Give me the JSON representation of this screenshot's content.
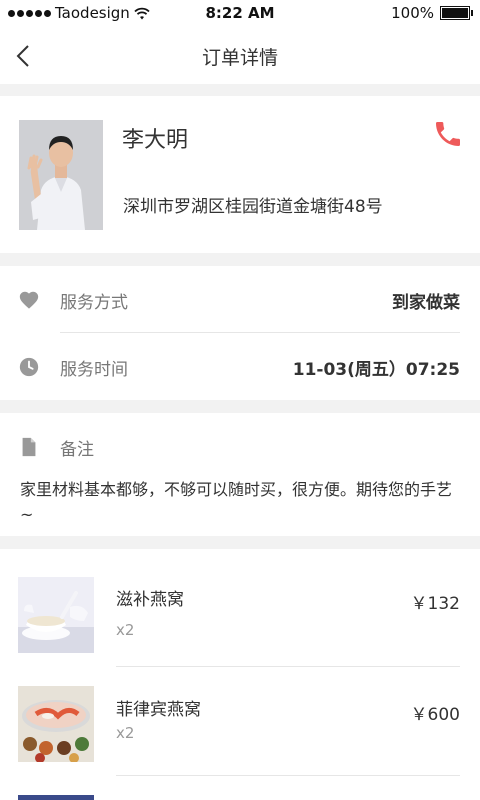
{
  "status_bar": {
    "carrier": "Taodesign",
    "time": "8:22 AM",
    "battery": "100%"
  },
  "nav": {
    "title": "订单详情"
  },
  "customer": {
    "name": "李大明",
    "address": "深圳市罗湖区桂园街道金塘街48号"
  },
  "service": {
    "method_label": "服务方式",
    "method_value": "到家做菜",
    "time_label": "服务时间",
    "time_value": "11-03(周五）07:25"
  },
  "remark": {
    "label": "备注",
    "text": "家里材料基本都够，不够可以随时买，很方便。期待您的手艺~"
  },
  "products": [
    {
      "name": "滋补燕窝",
      "qty": "x2",
      "price": "￥132"
    },
    {
      "name": "菲律宾燕窝",
      "qty": "x2",
      "price": "￥600"
    }
  ],
  "colors": {
    "accent": "#ee5a5a",
    "icon_gray": "#999999",
    "background": "#f2f2f2"
  }
}
